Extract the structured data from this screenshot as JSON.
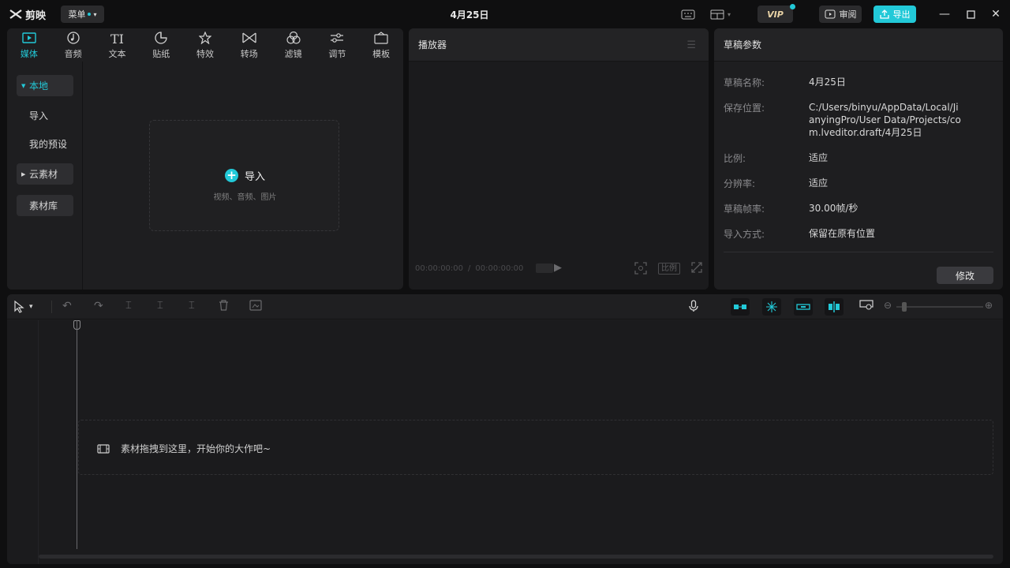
{
  "titlebar": {
    "logo": "剪映",
    "menu": "菜单",
    "doc_title": "4月25日",
    "vip": "VIP",
    "review": "审阅",
    "export": "导出"
  },
  "media": {
    "tabs": [
      {
        "label": "媒体",
        "icon": "media-icon"
      },
      {
        "label": "音频",
        "icon": "audio-icon"
      },
      {
        "label": "文本",
        "icon": "text-icon",
        "glyph": "TI"
      },
      {
        "label": "贴纸",
        "icon": "sticker-icon"
      },
      {
        "label": "特效",
        "icon": "effects-icon"
      },
      {
        "label": "转场",
        "icon": "transition-icon"
      },
      {
        "label": "滤镜",
        "icon": "filter-icon"
      },
      {
        "label": "调节",
        "icon": "adjust-icon"
      },
      {
        "label": "模板",
        "icon": "template-icon"
      }
    ],
    "side": {
      "local": "本地",
      "import": "导入",
      "presets": "我的预设",
      "cloud": "云素材",
      "library": "素材库"
    },
    "dropzone": {
      "title": "导入",
      "subtitle": "视频、音频、图片"
    }
  },
  "player": {
    "title": "播放器",
    "current_time": "00:00:00:00",
    "total_time": "00:00:00:00",
    "ratio": "比例"
  },
  "draft": {
    "title": "草稿参数",
    "rows": [
      {
        "label": "草稿名称:",
        "value": "4月25日"
      },
      {
        "label": "保存位置:",
        "value": "C:/Users/binyu/AppData/Local/JianyingPro/User Data/Projects/com.lveditor.draft/4月25日"
      },
      {
        "label": "比例:",
        "value": "适应"
      },
      {
        "label": "分辨率:",
        "value": "适应"
      },
      {
        "label": "草稿帧率:",
        "value": "30.00帧/秒"
      },
      {
        "label": "导入方式:",
        "value": "保留在原有位置"
      }
    ],
    "edit": "修改"
  },
  "timeline": {
    "hint": "素材拖拽到这里，开始你的大作吧~"
  },
  "colors": {
    "accent": "#22c9d8",
    "panel": "#1e1e20",
    "background": "#0f0f10"
  }
}
